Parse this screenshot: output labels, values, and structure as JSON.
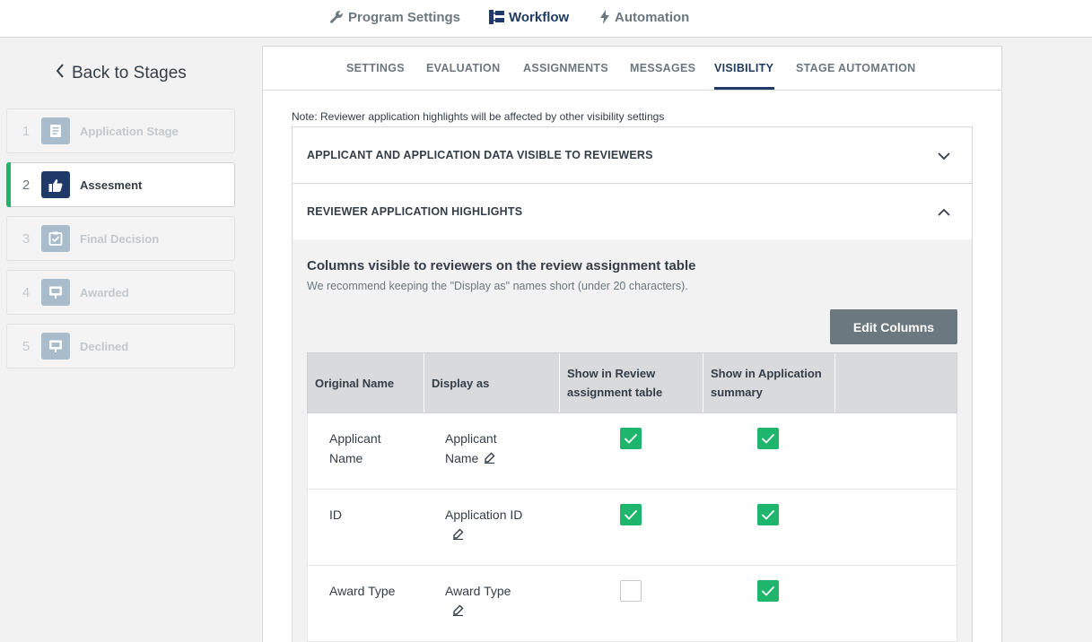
{
  "topnav": {
    "program_settings": "Program Settings",
    "workflow": "Workflow",
    "automation": "Automation"
  },
  "sidebar": {
    "back_label": "Back to Stages",
    "stages": [
      {
        "number": "1",
        "label": "Application Stage",
        "icon": "document-icon"
      },
      {
        "number": "2",
        "label": "Assesment",
        "icon": "thumbs-up-icon",
        "active": true
      },
      {
        "number": "3",
        "label": "Final Decision",
        "icon": "checklist-icon"
      },
      {
        "number": "4",
        "label": "Awarded",
        "icon": "presentation-icon"
      },
      {
        "number": "5",
        "label": "Declined",
        "icon": "presentation-icon"
      }
    ]
  },
  "tabs": [
    "SETTINGS",
    "EVALUATION",
    "ASSIGNMENTS",
    "MESSAGES",
    "VISIBILITY",
    "STAGE AUTOMATION"
  ],
  "active_tab": "VISIBILITY",
  "note": "Note: Reviewer application highlights will be affected by other visibility settings",
  "accordions": {
    "applicant_data": "APPLICANT AND APPLICATION DATA VISIBLE TO REVIEWERS",
    "highlights": "REVIEWER APPLICATION HIGHLIGHTS"
  },
  "columns_section": {
    "title": "Columns visible to reviewers on the review assignment table",
    "subtitle": "We recommend keeping the \"Display as\" names short (under 20 characters).",
    "edit_button": "Edit Columns"
  },
  "table": {
    "headers": {
      "original": "Original Name",
      "display": "Display as",
      "show_review_1": "Show in Review",
      "show_review_2": "assignment table",
      "show_app_1": "Show in Application",
      "show_app_2": "summary"
    },
    "rows": [
      {
        "original_1": "Applicant",
        "original_2": "Name",
        "display_1": "Applicant",
        "display_2": "Name",
        "show_review": true,
        "show_app": true
      },
      {
        "original_1": "ID",
        "original_2": "",
        "display_1": "Application ID",
        "display_2": "",
        "show_review": true,
        "show_app": true
      },
      {
        "original_1": "Award Type",
        "original_2": "",
        "display_1": "Award Type",
        "display_2": "",
        "show_review": false,
        "show_app": true
      }
    ]
  },
  "colors": {
    "accent_green": "#1fb56c",
    "navy": "#1f3a68",
    "gray_button": "#6b787f"
  }
}
